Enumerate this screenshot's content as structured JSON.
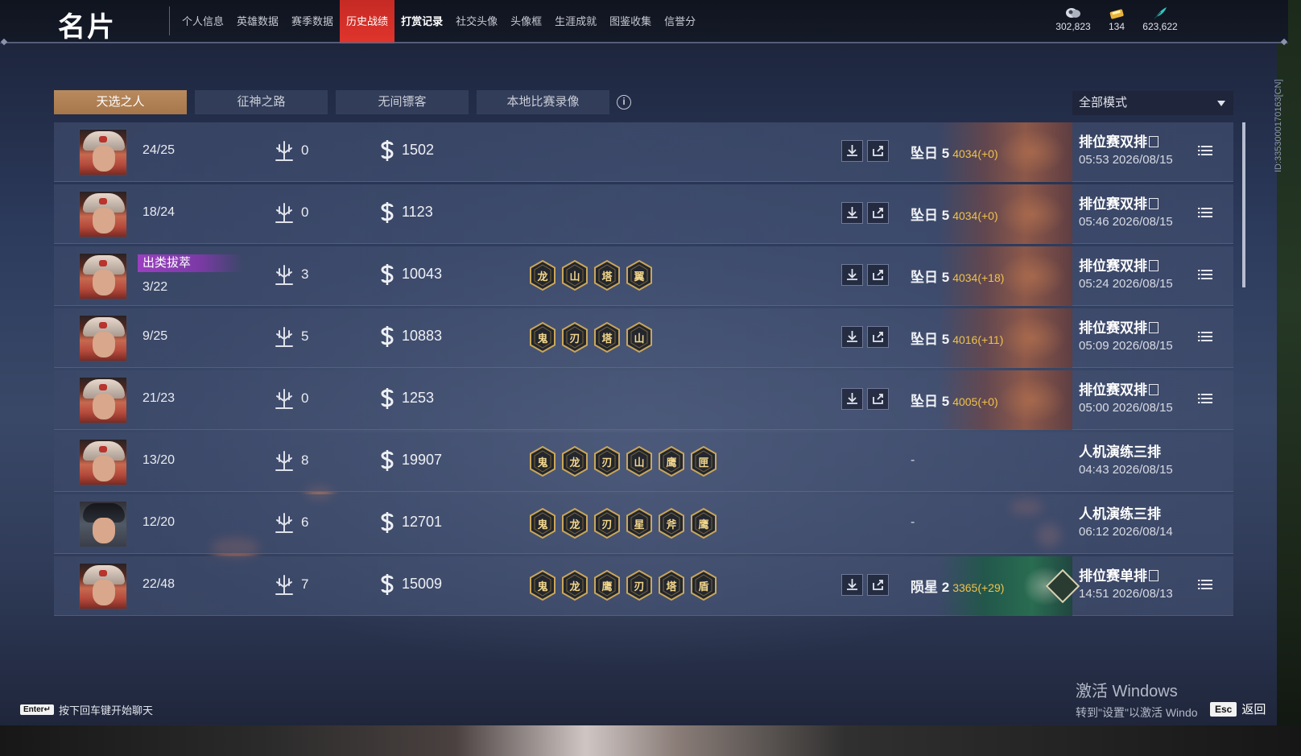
{
  "header": {
    "title": "名片",
    "nav": [
      {
        "label": "个人信息",
        "active": false,
        "bold": false,
        "dot": true
      },
      {
        "label": "英雄数据",
        "active": false,
        "bold": false
      },
      {
        "label": "赛季数据",
        "active": false,
        "bold": false
      },
      {
        "label": "历史战绩",
        "active": true,
        "bold": false
      },
      {
        "label": "打赏记录",
        "active": false,
        "bold": true
      },
      {
        "label": "社交头像",
        "active": false,
        "bold": false
      },
      {
        "label": "头像框",
        "active": false,
        "bold": false
      },
      {
        "label": "生涯成就",
        "active": false,
        "bold": false
      },
      {
        "label": "图鉴收集",
        "active": false,
        "bold": false
      },
      {
        "label": "信誉分",
        "active": false,
        "bold": false
      }
    ],
    "currencies": [
      {
        "icon": "coin-icon",
        "value": "302,823"
      },
      {
        "icon": "ticket-icon",
        "value": "134"
      },
      {
        "icon": "feather-icon",
        "value": "623,622"
      }
    ]
  },
  "tabs": [
    {
      "label": "天选之人",
      "active": true
    },
    {
      "label": "征神之路",
      "active": false
    },
    {
      "label": "无间镖客",
      "active": false
    },
    {
      "label": "本地比赛录像",
      "active": false
    }
  ],
  "mode_filter": {
    "selected": "全部模式"
  },
  "matches": [
    {
      "avatar": "red",
      "badge": "",
      "kda": "24/25",
      "mvp": "0",
      "gold": "1502",
      "honors": [],
      "actions": true,
      "rank": "坠日 5",
      "points": "4034(+0)",
      "rank_style": "gold",
      "mode": "排位赛双排",
      "time": "05:53  2026/08/15",
      "menu": true
    },
    {
      "avatar": "red",
      "badge": "",
      "kda": "18/24",
      "mvp": "0",
      "gold": "1123",
      "honors": [],
      "actions": true,
      "rank": "坠日 5",
      "points": "4034(+0)",
      "rank_style": "gold",
      "mode": "排位赛双排",
      "time": "05:46  2026/08/15",
      "menu": true
    },
    {
      "avatar": "red",
      "badge": "出类拔萃",
      "kda": "3/22",
      "mvp": "3",
      "gold": "10043",
      "honors": [
        "龙",
        "山",
        "塔",
        "翼"
      ],
      "actions": true,
      "rank": "坠日 5",
      "points": "4034(+18)",
      "rank_style": "gold",
      "mode": "排位赛双排",
      "time": "05:24  2026/08/15",
      "menu": true
    },
    {
      "avatar": "red",
      "badge": "",
      "kda": "9/25",
      "mvp": "5",
      "gold": "10883",
      "honors": [
        "鬼",
        "刃",
        "塔",
        "山"
      ],
      "actions": true,
      "rank": "坠日 5",
      "points": "4016(+11)",
      "rank_style": "gold",
      "mode": "排位赛双排",
      "time": "05:09  2026/08/15",
      "menu": true
    },
    {
      "avatar": "red",
      "badge": "",
      "kda": "21/23",
      "mvp": "0",
      "gold": "1253",
      "honors": [],
      "actions": true,
      "rank": "坠日 5",
      "points": "4005(+0)",
      "rank_style": "gold",
      "mode": "排位赛双排",
      "time": "05:00  2026/08/15",
      "menu": true
    },
    {
      "avatar": "red",
      "badge": "",
      "kda": "13/20",
      "mvp": "8",
      "gold": "19907",
      "honors": [
        "鬼",
        "龙",
        "刃",
        "山",
        "鹰",
        "匣"
      ],
      "actions": false,
      "rank": "-",
      "points": "",
      "rank_style": "none",
      "mode": "人机演练三排",
      "time": "04:43  2026/08/15",
      "menu": false
    },
    {
      "avatar": "alt",
      "badge": "",
      "kda": "12/20",
      "mvp": "6",
      "gold": "12701",
      "honors": [
        "鬼",
        "龙",
        "刃",
        "星",
        "斧",
        "鹰"
      ],
      "actions": false,
      "rank": "-",
      "points": "",
      "rank_style": "none",
      "mode": "人机演练三排",
      "time": "06:12  2026/08/14",
      "menu": false
    },
    {
      "avatar": "red",
      "badge": "",
      "kda": "22/48",
      "mvp": "7",
      "gold": "15009",
      "honors": [
        "鬼",
        "龙",
        "鹰",
        "刃",
        "塔",
        "盾"
      ],
      "actions": true,
      "rank": "陨星 2",
      "points": "3365(+29)",
      "rank_style": "green",
      "mode": "排位赛单排",
      "time": "14:51  2026/08/13",
      "menu": true
    }
  ],
  "side_id": "ID:3353000170163[CN]",
  "footer": {
    "enter_key": "Enter↵",
    "chat_hint": "按下回车键开始聊天",
    "watermark_line1": "激活 Windows",
    "watermark_line2": "转到\"设置\"以激活 Windo",
    "esc_key": "Esc",
    "back_label": "返回"
  }
}
